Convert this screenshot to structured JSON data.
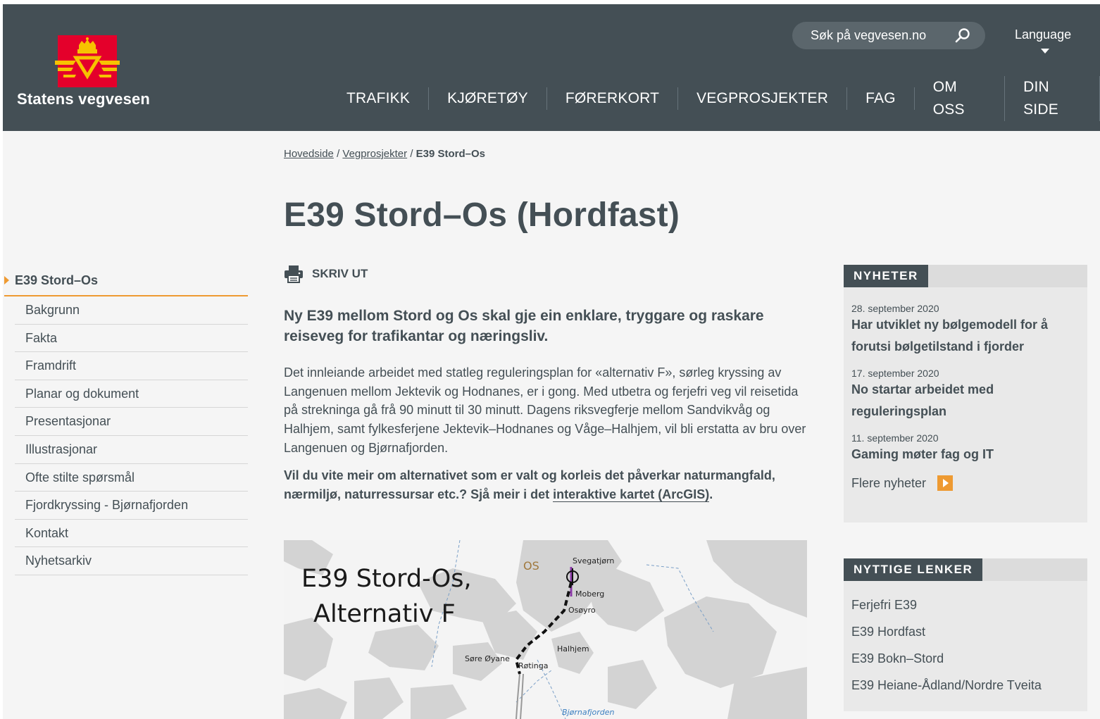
{
  "header": {
    "brand": "Statens vegvesen",
    "search_placeholder": "Søk på vegvesen.no",
    "language": "Language",
    "nav": [
      "TRAFIKK",
      "KJØRETØY",
      "FØRERKORT",
      "VEGPROSJEKTER",
      "FAG",
      "OM OSS",
      "DIN SIDE"
    ]
  },
  "breadcrumb": {
    "home": "Hovedside",
    "sep": "/",
    "section": "Vegprosjekter",
    "current": "E39 Stord–Os"
  },
  "page_title": "E39 Stord–Os (Hordfast)",
  "sidebar": {
    "heading": "E39 Stord–Os",
    "items": [
      "Bakgrunn",
      "Fakta",
      "Framdrift",
      "Planar og dokument",
      "Presentasjonar",
      "Illustrasjonar",
      "Ofte stilte spørsmål",
      "Fjordkryssing - Bjørnafjorden",
      "Kontakt",
      "Nyhetsarkiv"
    ]
  },
  "main": {
    "print_label": "SKRIV UT",
    "lead": "Ny E39 mellom Stord og Os skal gje ein enklare, tryggare og raskare reiseveg for trafikantar og næringsliv.",
    "body": "Det innleiande arbeidet med statleg reguleringsplan for «alternativ F», sørleg kryssing av Langenuen mellom Jektevik og Hodnanes, er i gong. Med utbetra og ferjefri veg vil reisetida på strekninga gå frå 90 minutt til 30 minutt. Dagens riksvegferje mellom Sandvikvåg og Halhjem, samt fylkesferjene Jektevik–Hodnanes og Våge–Halhjem, vil bli erstatta av bru over Langenuen og Bjørnafjorden.",
    "bold_text": "Vil du vite meir om alternativet som er valt og korleis det påverkar naturmangfald, nærmiljø, naturressursar etc.? Sjå meir i det ",
    "bold_link": "interaktive kartet (ArcGIS)",
    "bold_end": "."
  },
  "map": {
    "title_line1": "E39 Stord-Os,",
    "title_line2": "Alternativ F",
    "labels": {
      "os": "OS",
      "svegatjorn": "Svegatjørn",
      "moberg": "Moberg",
      "osoyro": "Osøyro",
      "halhjem": "Halhjem",
      "sore_oyane": "Søre Øyane",
      "rotinga": "Røtinga",
      "bjornafjorden": "Bjørnafjorden"
    }
  },
  "news": {
    "heading": "NYHETER",
    "items": [
      {
        "date": "28. september 2020",
        "title": "Har utviklet ny bølgemodell for å forutsi bølgetilstand i fjorder"
      },
      {
        "date": "17. september 2020",
        "title": "No startar arbeidet med reguleringsplan"
      },
      {
        "date": "11. september 2020",
        "title": "Gaming møter fag og IT"
      }
    ],
    "more": "Flere nyheter"
  },
  "links": {
    "heading": "NYTTIGE LENKER",
    "items": [
      "Ferjefri E39",
      "E39 Hordfast",
      "E39 Bokn–Stord",
      "E39 Heiane-Ådland/Nordre Tveita"
    ]
  },
  "colors": {
    "header_bg": "#444f55",
    "accent": "#ee9a32",
    "logo_red": "#e4002b",
    "logo_gold": "#f7c200"
  }
}
